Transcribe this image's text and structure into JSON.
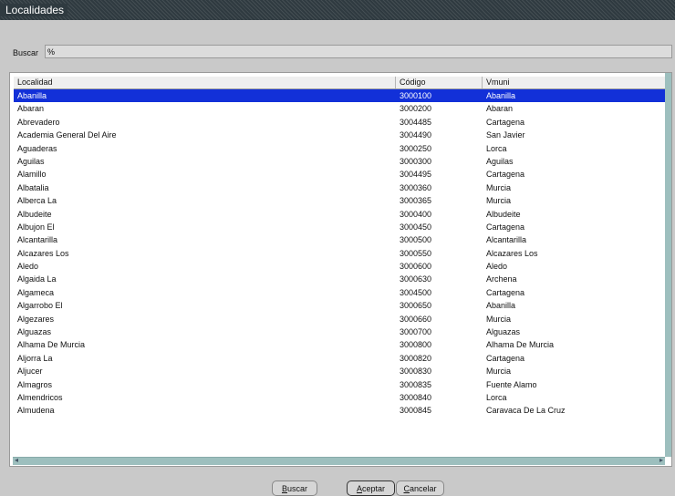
{
  "window": {
    "title": "Localidades"
  },
  "search": {
    "label": "Buscar",
    "value": "%"
  },
  "table": {
    "columns": [
      "Localidad",
      "Código",
      "Vmuni"
    ],
    "rows": [
      [
        "Abanilla",
        "3000100",
        "Abanilla"
      ],
      [
        "Abaran",
        "3000200",
        "Abaran"
      ],
      [
        "Abrevadero",
        "3004485",
        "Cartagena"
      ],
      [
        "Academia General Del Aire",
        "3004490",
        "San Javier"
      ],
      [
        "Aguaderas",
        "3000250",
        "Lorca"
      ],
      [
        "Aguilas",
        "3000300",
        "Aguilas"
      ],
      [
        "Alamillo",
        "3004495",
        "Cartagena"
      ],
      [
        "Albatalia",
        "3000360",
        "Murcia"
      ],
      [
        "Alberca La",
        "3000365",
        "Murcia"
      ],
      [
        "Albudeite",
        "3000400",
        "Albudeite"
      ],
      [
        "Albujon El",
        "3000450",
        "Cartagena"
      ],
      [
        "Alcantarilla",
        "3000500",
        "Alcantarilla"
      ],
      [
        "Alcazares Los",
        "3000550",
        "Alcazares Los"
      ],
      [
        "Aledo",
        "3000600",
        "Aledo"
      ],
      [
        "Algaida La",
        "3000630",
        "Archena"
      ],
      [
        "Algameca",
        "3004500",
        "Cartagena"
      ],
      [
        "Algarrobo El",
        "3000650",
        "Abanilla"
      ],
      [
        "Algezares",
        "3000660",
        "Murcia"
      ],
      [
        "Alguazas",
        "3000700",
        "Alguazas"
      ],
      [
        "Alhama De Murcia",
        "3000800",
        "Alhama De Murcia"
      ],
      [
        "Aljorra La",
        "3000820",
        "Cartagena"
      ],
      [
        "Aljucer",
        "3000830",
        "Murcia"
      ],
      [
        "Almagros",
        "3000835",
        "Fuente Alamo"
      ],
      [
        "Almendricos",
        "3000840",
        "Lorca"
      ],
      [
        "Almudena",
        "3000845",
        "Caravaca De La Cruz"
      ]
    ],
    "selected_index": 0
  },
  "buttons": {
    "search": "Buscar",
    "accept": "Aceptar",
    "cancel": "Cancelar"
  }
}
